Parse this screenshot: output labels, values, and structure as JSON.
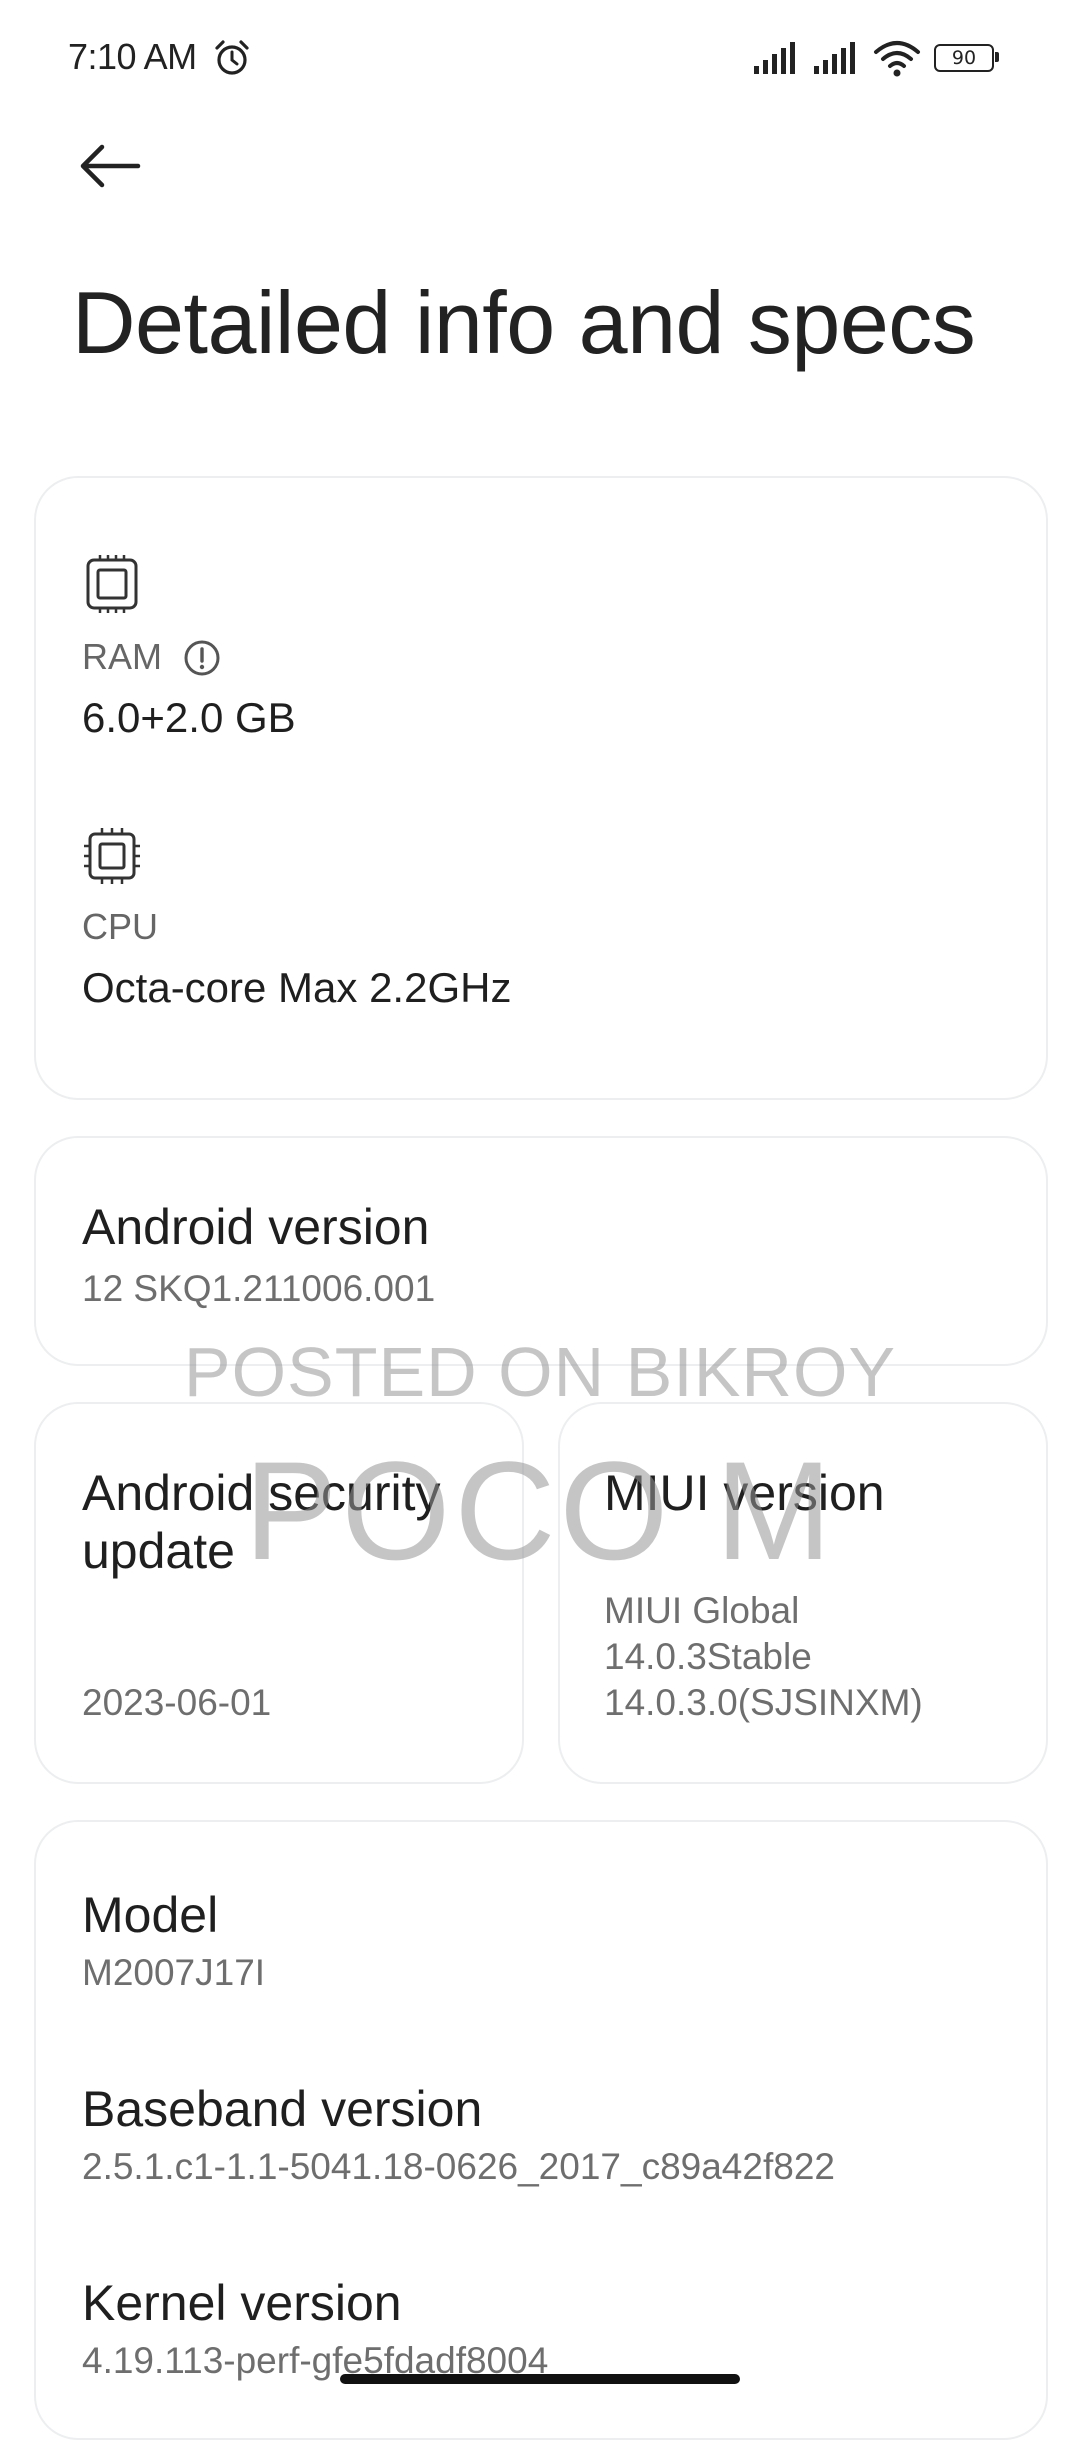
{
  "status_bar": {
    "time": "7:10 AM",
    "battery_level": "90",
    "icons": [
      "alarm-icon",
      "cell-signal-icon",
      "cell-signal-icon",
      "wifi-icon",
      "battery-icon"
    ]
  },
  "header": {
    "back_icon": "arrow-left-icon",
    "title": "Detailed info and specs"
  },
  "hardware": {
    "ram": {
      "icon": "chip-icon",
      "label": "RAM",
      "info_icon": "info-icon",
      "value": "6.0+2.0 GB"
    },
    "cpu": {
      "icon": "cpu-icon",
      "label": "CPU",
      "value": "Octa-core Max 2.2GHz"
    }
  },
  "android_version": {
    "title": "Android version",
    "value": "12 SKQ1.211006.001"
  },
  "security_update": {
    "title_line1": "Android security",
    "title_line2": "update",
    "value": "2023-06-01"
  },
  "miui_version": {
    "title": "MIUI version",
    "line1": "MIUI Global",
    "line2": "14.0.3Stable",
    "line3": "14.0.3.0(SJSINXM)"
  },
  "device": {
    "model": {
      "title": "Model",
      "value": "M2007J17I"
    },
    "baseband": {
      "title": "Baseband version",
      "value": "2.5.1.c1-1.1-5041.18-0626_2017_c89a42f822"
    },
    "kernel": {
      "title": "Kernel version",
      "value": "4.19.113-perf-gfe5fdadf8004"
    }
  },
  "watermark": {
    "line1": "POSTED ON BIKROY",
    "line2": "POCO M"
  },
  "colors": {
    "background": "#ffffff",
    "card_border": "#eceeef",
    "primary_text": "#1f1f1f",
    "secondary_text": "#6e6e6e"
  }
}
